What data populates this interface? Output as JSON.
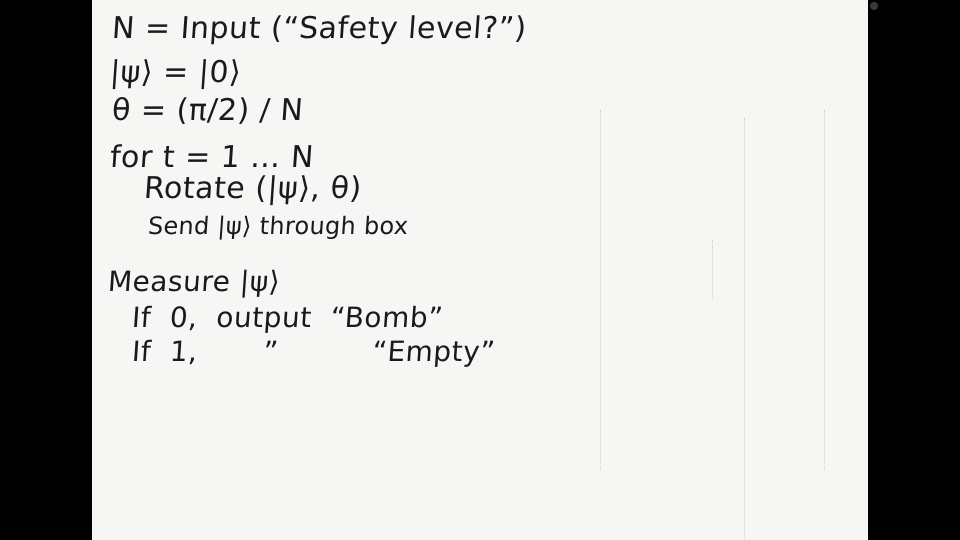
{
  "notes": {
    "line1": "N = Input (“Safety level?”)",
    "line2": "|ψ⟩ = |0⟩",
    "line3": "θ = (π/2) / N",
    "line4": "for t = 1 … N",
    "line5": "Rotate (|ψ⟩, θ)",
    "line6": "Send |ψ⟩ through box",
    "line7": "Measure |ψ⟩",
    "line8": "If  0,  output  “Bomb”",
    "line9": "If  1,       ”          “Empty”"
  },
  "colors": {
    "background": "#000000",
    "paper": "#f6f6f4",
    "ink": "#1a1a1a"
  }
}
